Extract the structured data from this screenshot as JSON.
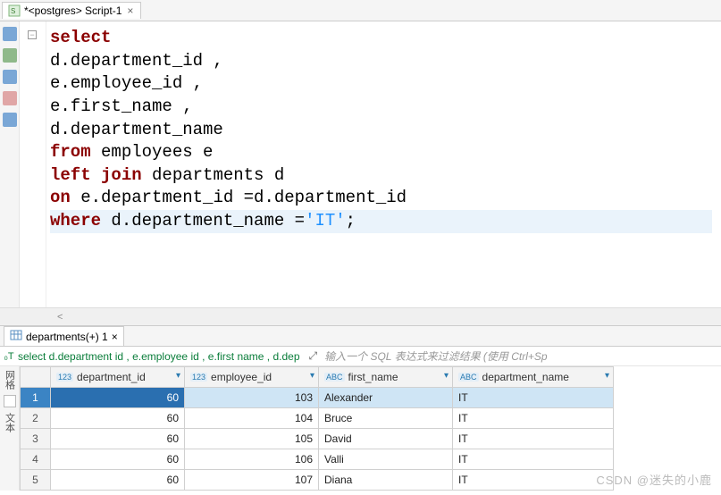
{
  "editor_tab": {
    "label": "*<postgres> Script-1",
    "close": "×"
  },
  "sql": {
    "l1_kw": "select",
    "l2": "d.department_id ,",
    "l3": "e.employee_id ,",
    "l4": "e.first_name ,",
    "l5": "d.department_name",
    "l6_kw1": "from",
    "l6_id": " employees e",
    "l7_kw1": "left",
    "l7_kw2": "join",
    "l7_id": " departments d",
    "l8_kw": "on",
    "l8_id": " e.department_id =d.department_id",
    "l9_kw": "where",
    "l9_id": " d.department_name =",
    "l9_str": "'IT'",
    "l9_end": ";"
  },
  "results_tab": {
    "label": "departments(+) 1",
    "close": "×"
  },
  "query_preview": "select d.department id , e.employee id , e.first name , d.dep",
  "filter_placeholder": "输入一个 SQL 表达式来过滤结果 (使用 Ctrl+Sp",
  "columns": [
    {
      "name": "department_id",
      "type": "123"
    },
    {
      "name": "employee_id",
      "type": "123"
    },
    {
      "name": "first_name",
      "type": "ABC"
    },
    {
      "name": "department_name",
      "type": "ABC"
    }
  ],
  "rows": [
    {
      "n": "1",
      "department_id": "60",
      "employee_id": "103",
      "first_name": "Alexander",
      "department_name": "IT"
    },
    {
      "n": "2",
      "department_id": "60",
      "employee_id": "104",
      "first_name": "Bruce",
      "department_name": "IT"
    },
    {
      "n": "3",
      "department_id": "60",
      "employee_id": "105",
      "first_name": "David",
      "department_name": "IT"
    },
    {
      "n": "4",
      "department_id": "60",
      "employee_id": "106",
      "first_name": "Valli",
      "department_name": "IT"
    },
    {
      "n": "5",
      "department_id": "60",
      "employee_id": "107",
      "first_name": "Diana",
      "department_name": "IT"
    }
  ],
  "side_labels": {
    "grid": "网格",
    "text": "文本"
  },
  "watermark": "CSDN @迷失的小鹿",
  "fold_marker": "−",
  "scroll_arrow": "<"
}
